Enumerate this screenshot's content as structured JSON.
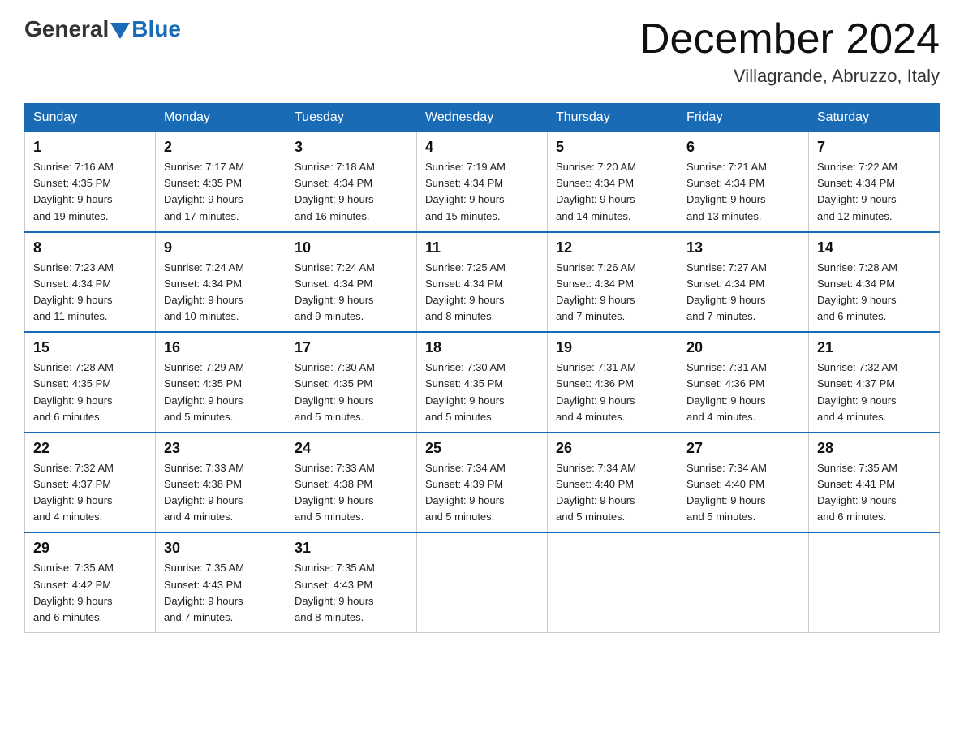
{
  "header": {
    "logo_general": "General",
    "logo_blue": "Blue",
    "month_title": "December 2024",
    "location": "Villagrande, Abruzzo, Italy"
  },
  "days_of_week": [
    "Sunday",
    "Monday",
    "Tuesday",
    "Wednesday",
    "Thursday",
    "Friday",
    "Saturday"
  ],
  "weeks": [
    [
      {
        "day": "1",
        "sunrise": "7:16 AM",
        "sunset": "4:35 PM",
        "daylight": "9 hours and 19 minutes."
      },
      {
        "day": "2",
        "sunrise": "7:17 AM",
        "sunset": "4:35 PM",
        "daylight": "9 hours and 17 minutes."
      },
      {
        "day": "3",
        "sunrise": "7:18 AM",
        "sunset": "4:34 PM",
        "daylight": "9 hours and 16 minutes."
      },
      {
        "day": "4",
        "sunrise": "7:19 AM",
        "sunset": "4:34 PM",
        "daylight": "9 hours and 15 minutes."
      },
      {
        "day": "5",
        "sunrise": "7:20 AM",
        "sunset": "4:34 PM",
        "daylight": "9 hours and 14 minutes."
      },
      {
        "day": "6",
        "sunrise": "7:21 AM",
        "sunset": "4:34 PM",
        "daylight": "9 hours and 13 minutes."
      },
      {
        "day": "7",
        "sunrise": "7:22 AM",
        "sunset": "4:34 PM",
        "daylight": "9 hours and 12 minutes."
      }
    ],
    [
      {
        "day": "8",
        "sunrise": "7:23 AM",
        "sunset": "4:34 PM",
        "daylight": "9 hours and 11 minutes."
      },
      {
        "day": "9",
        "sunrise": "7:24 AM",
        "sunset": "4:34 PM",
        "daylight": "9 hours and 10 minutes."
      },
      {
        "day": "10",
        "sunrise": "7:24 AM",
        "sunset": "4:34 PM",
        "daylight": "9 hours and 9 minutes."
      },
      {
        "day": "11",
        "sunrise": "7:25 AM",
        "sunset": "4:34 PM",
        "daylight": "9 hours and 8 minutes."
      },
      {
        "day": "12",
        "sunrise": "7:26 AM",
        "sunset": "4:34 PM",
        "daylight": "9 hours and 7 minutes."
      },
      {
        "day": "13",
        "sunrise": "7:27 AM",
        "sunset": "4:34 PM",
        "daylight": "9 hours and 7 minutes."
      },
      {
        "day": "14",
        "sunrise": "7:28 AM",
        "sunset": "4:34 PM",
        "daylight": "9 hours and 6 minutes."
      }
    ],
    [
      {
        "day": "15",
        "sunrise": "7:28 AM",
        "sunset": "4:35 PM",
        "daylight": "9 hours and 6 minutes."
      },
      {
        "day": "16",
        "sunrise": "7:29 AM",
        "sunset": "4:35 PM",
        "daylight": "9 hours and 5 minutes."
      },
      {
        "day": "17",
        "sunrise": "7:30 AM",
        "sunset": "4:35 PM",
        "daylight": "9 hours and 5 minutes."
      },
      {
        "day": "18",
        "sunrise": "7:30 AM",
        "sunset": "4:35 PM",
        "daylight": "9 hours and 5 minutes."
      },
      {
        "day": "19",
        "sunrise": "7:31 AM",
        "sunset": "4:36 PM",
        "daylight": "9 hours and 4 minutes."
      },
      {
        "day": "20",
        "sunrise": "7:31 AM",
        "sunset": "4:36 PM",
        "daylight": "9 hours and 4 minutes."
      },
      {
        "day": "21",
        "sunrise": "7:32 AM",
        "sunset": "4:37 PM",
        "daylight": "9 hours and 4 minutes."
      }
    ],
    [
      {
        "day": "22",
        "sunrise": "7:32 AM",
        "sunset": "4:37 PM",
        "daylight": "9 hours and 4 minutes."
      },
      {
        "day": "23",
        "sunrise": "7:33 AM",
        "sunset": "4:38 PM",
        "daylight": "9 hours and 4 minutes."
      },
      {
        "day": "24",
        "sunrise": "7:33 AM",
        "sunset": "4:38 PM",
        "daylight": "9 hours and 5 minutes."
      },
      {
        "day": "25",
        "sunrise": "7:34 AM",
        "sunset": "4:39 PM",
        "daylight": "9 hours and 5 minutes."
      },
      {
        "day": "26",
        "sunrise": "7:34 AM",
        "sunset": "4:40 PM",
        "daylight": "9 hours and 5 minutes."
      },
      {
        "day": "27",
        "sunrise": "7:34 AM",
        "sunset": "4:40 PM",
        "daylight": "9 hours and 5 minutes."
      },
      {
        "day": "28",
        "sunrise": "7:35 AM",
        "sunset": "4:41 PM",
        "daylight": "9 hours and 6 minutes."
      }
    ],
    [
      {
        "day": "29",
        "sunrise": "7:35 AM",
        "sunset": "4:42 PM",
        "daylight": "9 hours and 6 minutes."
      },
      {
        "day": "30",
        "sunrise": "7:35 AM",
        "sunset": "4:43 PM",
        "daylight": "9 hours and 7 minutes."
      },
      {
        "day": "31",
        "sunrise": "7:35 AM",
        "sunset": "4:43 PM",
        "daylight": "9 hours and 8 minutes."
      },
      null,
      null,
      null,
      null
    ]
  ],
  "labels": {
    "sunrise": "Sunrise:",
    "sunset": "Sunset:",
    "daylight": "Daylight:"
  }
}
